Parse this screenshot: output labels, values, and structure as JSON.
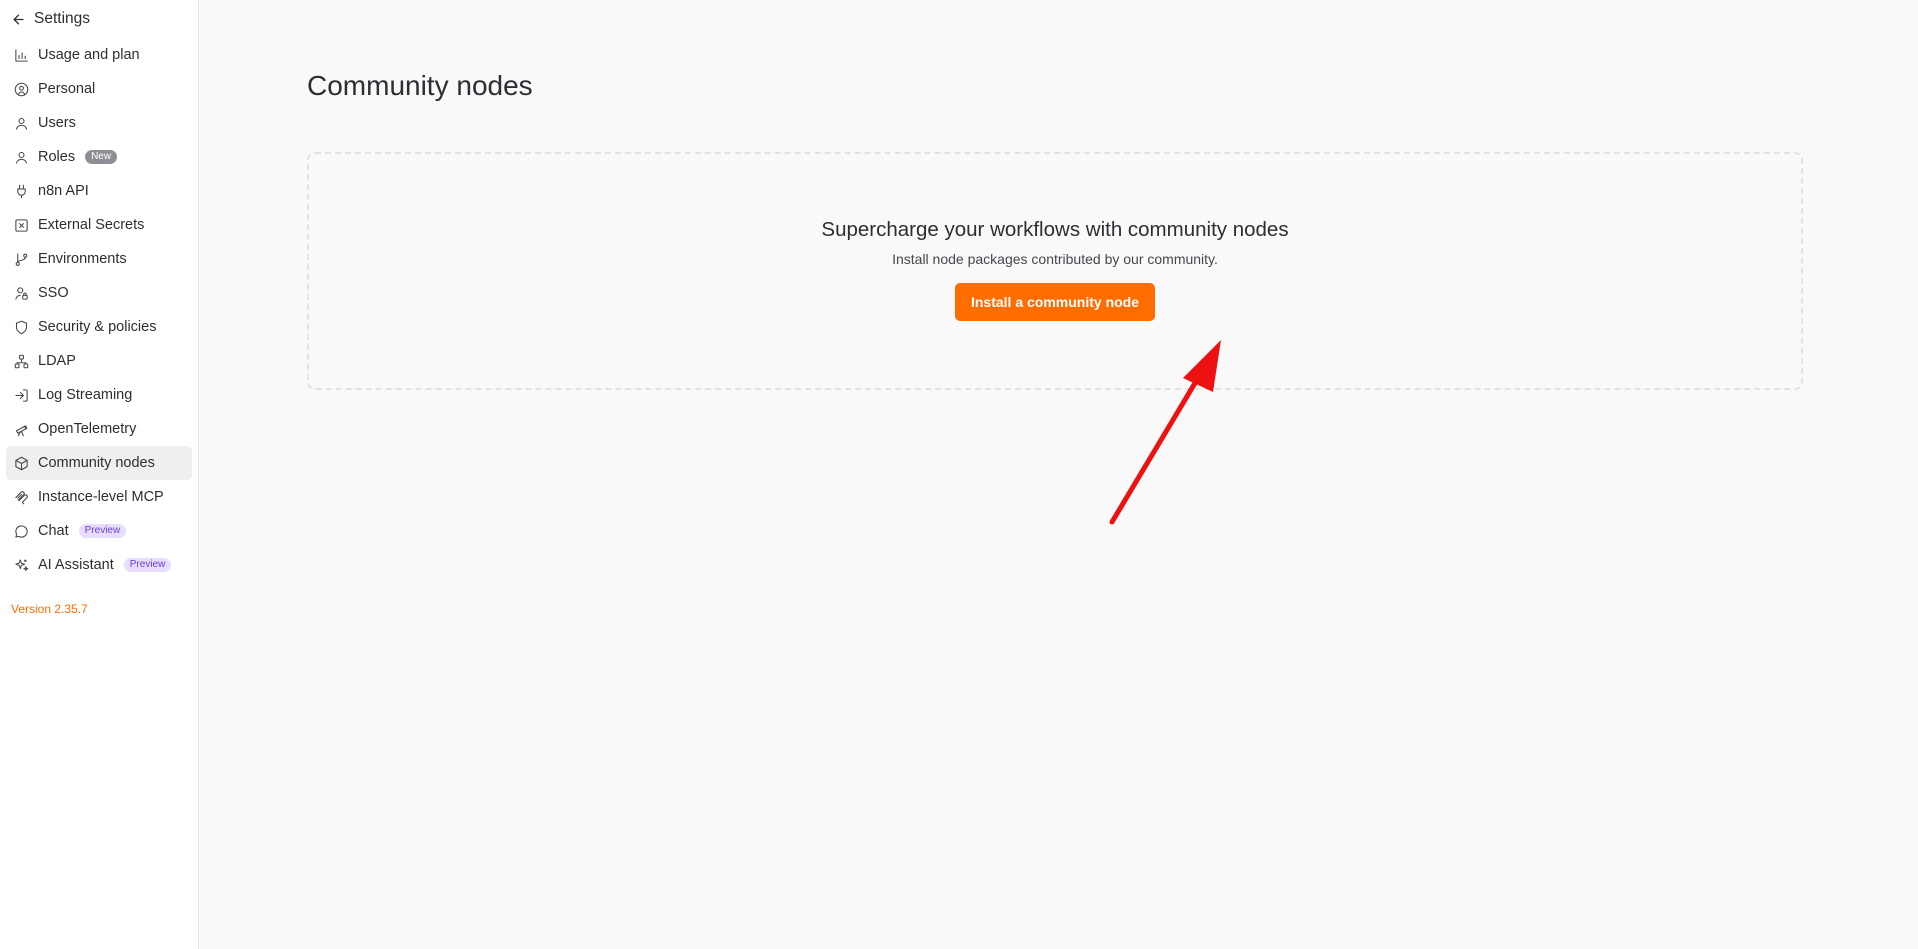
{
  "sidebar": {
    "back_label": "Settings",
    "items": [
      {
        "label": "Usage and plan",
        "icon": "chart-icon"
      },
      {
        "label": "Personal",
        "icon": "user-circle-icon"
      },
      {
        "label": "Users",
        "icon": "user-icon"
      },
      {
        "label": "Roles",
        "icon": "user-icon",
        "badge": "New"
      },
      {
        "label": "n8n API",
        "icon": "plug-icon"
      },
      {
        "label": "External Secrets",
        "icon": "box-x-icon"
      },
      {
        "label": "Environments",
        "icon": "git-branch-icon"
      },
      {
        "label": "SSO",
        "icon": "user-lock-icon"
      },
      {
        "label": "Security & policies",
        "icon": "shield-icon"
      },
      {
        "label": "LDAP",
        "icon": "network-icon"
      },
      {
        "label": "Log Streaming",
        "icon": "log-in-icon"
      },
      {
        "label": "OpenTelemetry",
        "icon": "telescope-icon"
      },
      {
        "label": "Community nodes",
        "icon": "package-icon",
        "active": true
      },
      {
        "label": "Instance-level MCP",
        "icon": "mcp-icon"
      },
      {
        "label": "Chat",
        "icon": "message-circle-icon",
        "badge": "Preview"
      },
      {
        "label": "AI Assistant",
        "icon": "sparkles-icon",
        "badge": "Preview"
      }
    ],
    "version": "Version 2.35.7"
  },
  "main": {
    "title": "Community nodes",
    "empty_state": {
      "heading": "Supercharge your workflows with community nodes",
      "description": "Install node packages contributed by our community.",
      "button_label": "Install a community node"
    }
  },
  "colors": {
    "accent": "#ff6d00",
    "annotation": "#ee1111",
    "badge_preview_bg": "#e8ddff",
    "badge_preview_text": "#6a3fdc"
  }
}
